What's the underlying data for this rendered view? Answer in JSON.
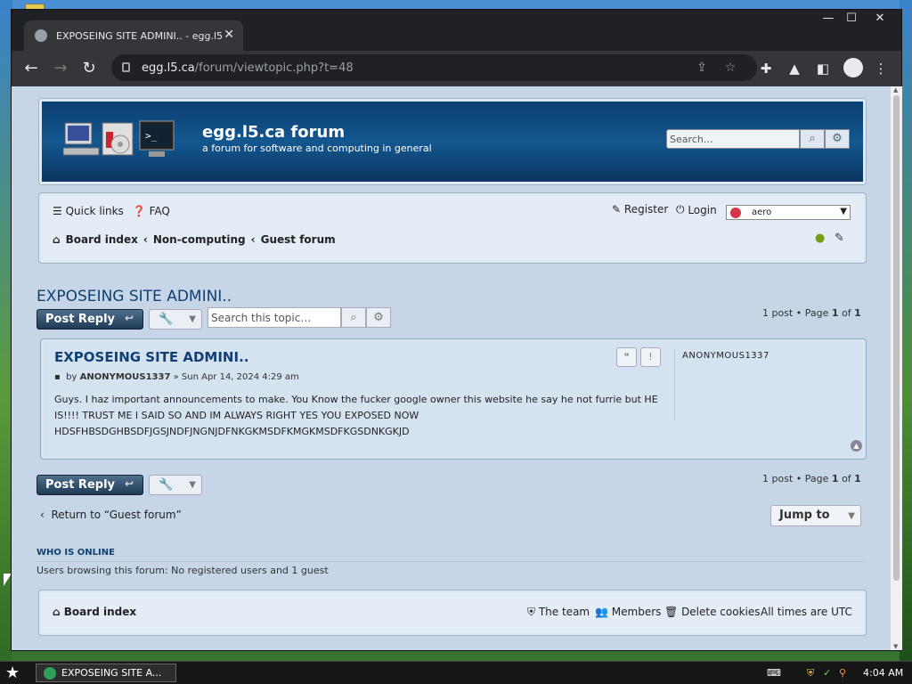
{
  "browser": {
    "tab_title": "EXPOSEING SITE ADMINI.. - egg.l5",
    "url_host": "egg.l5.ca",
    "url_path": "/forum/viewtopic.php?t=48"
  },
  "header": {
    "site_title": "egg.l5.ca forum",
    "site_description": "a forum for software and computing in general",
    "search_placeholder": "Search…"
  },
  "nav": {
    "quick_links": "Quick links",
    "faq": "FAQ",
    "register": "Register",
    "login": "Login",
    "style_select": "aero",
    "breadcrumbs": [
      "Board index",
      "Non-computing",
      "Guest forum"
    ]
  },
  "topic": {
    "title": "EXPOSEING SITE ADMINI..",
    "post_reply": "Post Reply",
    "search_placeholder": "Search this topic…",
    "pagination": {
      "posts": "1 post",
      "bullet": "•",
      "page_label": "Page",
      "current": "1",
      "of": "of",
      "total": "1"
    }
  },
  "post": {
    "subject": "EXPOSEING SITE ADMINI..",
    "by_label": "by",
    "author": "ANONYMOUS1337",
    "date": "» Sun Apr 14, 2024 4:29 am",
    "body": "Guys. I haz important announcements to make. You Know the fucker google owner this website he say he not furrie but HE IS!!!! TRUST ME I SAID SO AND IM ALWAYS RIGHT YES YOU EXPOSED NOW HDSFHBSDGHBSDFJGSJNDFJNGNJDFNKGKMSDFKMGKMSDFKGSDNKGKJD",
    "profile_name": "ANONYMOUS1337"
  },
  "actions": {
    "return_link": "Return to “Guest forum”",
    "jump_to": "Jump to"
  },
  "online": {
    "heading": "WHO IS ONLINE",
    "text": "Users browsing this forum: No registered users and 1 guest"
  },
  "footer": {
    "board_index": "Board index",
    "the_team": "The team",
    "members": "Members",
    "delete_cookies": "Delete cookies",
    "timezone": "All times are UTC"
  },
  "taskbar": {
    "task_title": "EXPOSEING SITE A...",
    "clock": "4:04 AM"
  },
  "colors": {
    "header_blue": "#13578f",
    "title_blue": "#104073",
    "page_bg": "#c7d6e6"
  }
}
